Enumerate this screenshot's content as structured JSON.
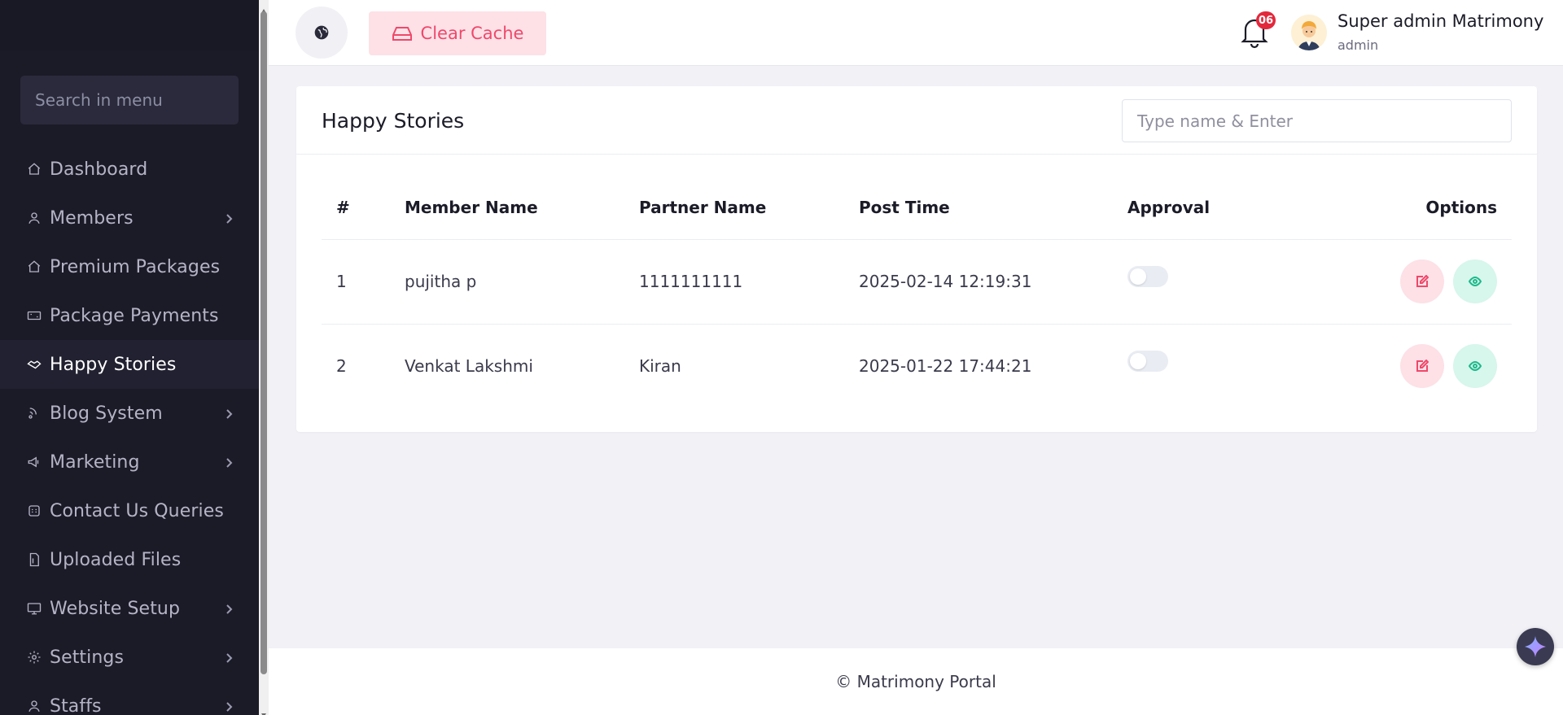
{
  "sidebar": {
    "search_placeholder": "Search in menu",
    "items": [
      {
        "label": "Dashboard",
        "icon": "home-icon",
        "has_children": false,
        "active": false
      },
      {
        "label": "Members",
        "icon": "user-icon",
        "has_children": true,
        "active": false
      },
      {
        "label": "Premium Packages",
        "icon": "home-icon",
        "has_children": false,
        "active": false
      },
      {
        "label": "Package Payments",
        "icon": "money-icon",
        "has_children": false,
        "active": false
      },
      {
        "label": "Happy Stories",
        "icon": "handshake-icon",
        "has_children": false,
        "active": true
      },
      {
        "label": "Blog System",
        "icon": "blog-icon",
        "has_children": true,
        "active": false
      },
      {
        "label": "Marketing",
        "icon": "megaphone-icon",
        "has_children": true,
        "active": false
      },
      {
        "label": "Contact Us Queries",
        "icon": "phone-icon",
        "has_children": false,
        "active": false
      },
      {
        "label": "Uploaded Files",
        "icon": "file-icon",
        "has_children": false,
        "active": false
      },
      {
        "label": "Website Setup",
        "icon": "monitor-icon",
        "has_children": true,
        "active": false
      },
      {
        "label": "Settings",
        "icon": "gear-icon",
        "has_children": true,
        "active": false
      },
      {
        "label": "Staffs",
        "icon": "user-icon",
        "has_children": true,
        "active": false
      }
    ]
  },
  "header": {
    "clear_cache_label": "Clear Cache",
    "notification_count": "06",
    "user_name": "Super admin Matrimony",
    "user_role": "admin"
  },
  "page": {
    "title": "Happy Stories",
    "search_placeholder": "Type name & Enter"
  },
  "table": {
    "columns": [
      "#",
      "Member Name",
      "Partner Name",
      "Post Time",
      "Approval",
      "Options"
    ],
    "rows": [
      {
        "num": "1",
        "member": "pujitha p",
        "partner": "1111111111",
        "post_time": "2025-02-14 12:19:31",
        "approved": false
      },
      {
        "num": "2",
        "member": "Venkat Lakshmi",
        "partner": "Kiran",
        "post_time": "2025-01-22 17:44:21",
        "approved": false
      }
    ]
  },
  "footer": {
    "text": "© Matrimony Portal"
  },
  "colors": {
    "sidebar_bg": "#1b1b28",
    "accent_pink": "#ef486a",
    "accent_green": "#1cb98a",
    "badge_red": "#e3283c"
  }
}
